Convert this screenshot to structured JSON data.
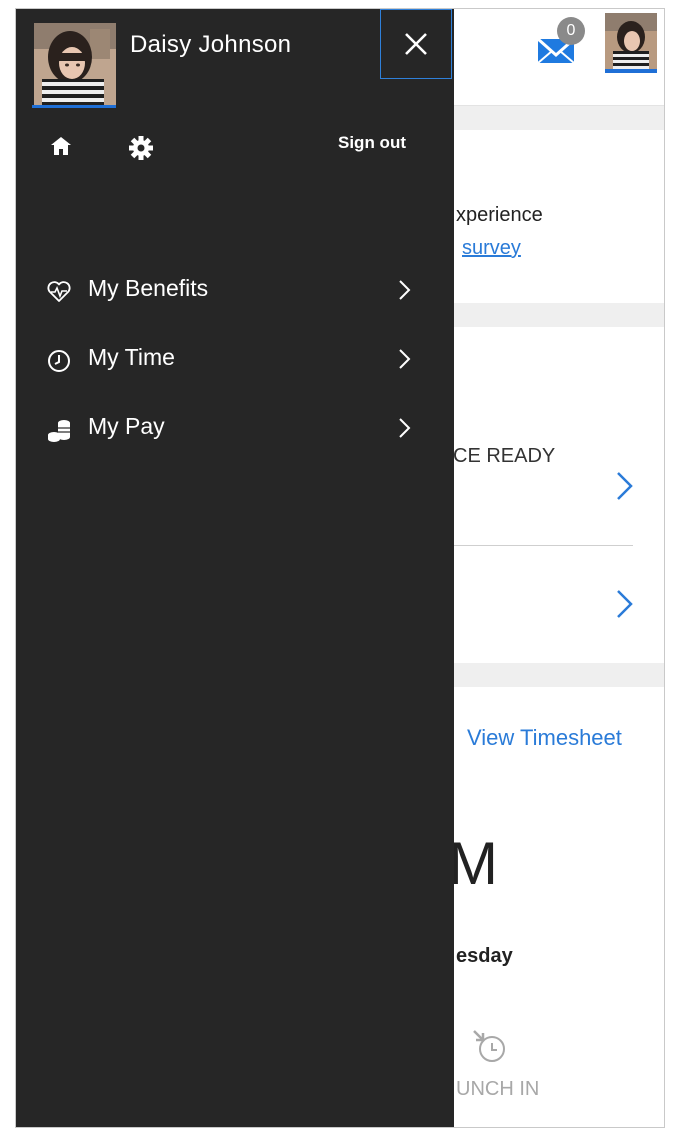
{
  "drawer": {
    "user_name": "Daisy Johnson",
    "close_icon": "close-icon",
    "sign_out_label": "Sign out",
    "menu": [
      {
        "label": "My Benefits",
        "icon": "heart-pulse-icon"
      },
      {
        "label": "My Time",
        "icon": "clock-icon"
      },
      {
        "label": "My Pay",
        "icon": "coins-icon"
      }
    ]
  },
  "background": {
    "mail_count": "0",
    "survey_line1": "xperience",
    "survey_link": "survey",
    "ready_text": "CE READY",
    "view_timesheet": "View Timesheet",
    "time_partial": "M",
    "day_partial": "esday",
    "punch_partial": "UNCH IN"
  },
  "colors": {
    "drawer_bg": "#262626",
    "accent_blue": "#2a7bd8",
    "page_gap": "#efefef"
  }
}
